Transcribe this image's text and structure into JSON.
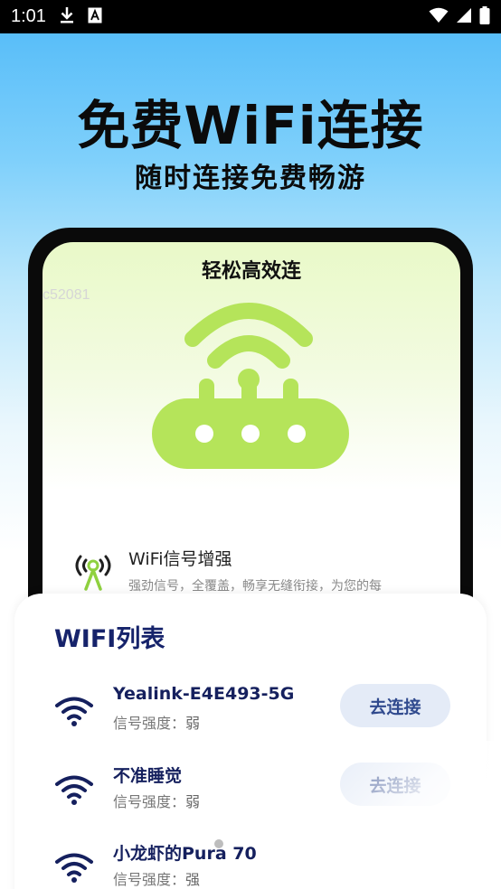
{
  "status_bar": {
    "time": "1:01",
    "icons_left": [
      "download-icon",
      "a-box-icon"
    ],
    "icons_right": [
      "wifi-signal-icon",
      "cell-signal-icon",
      "battery-icon"
    ]
  },
  "hero": {
    "title": "免费WiFi连接",
    "subtitle": "随时连接免费畅游"
  },
  "phone_mock": {
    "screen_title": "轻松高效连",
    "watermark": "c52081",
    "accent_color": "#b5e45a",
    "feature": {
      "title": "WiFi信号增强",
      "description": "强劲信号，全覆盖，畅享无缝衔接，为您的每"
    }
  },
  "wifi_list": {
    "title": "WIFI列表",
    "strength_label": "信号强度：",
    "items": [
      {
        "name": "Yealink-E4E493-5G",
        "strength": "弱",
        "button": "去连接"
      },
      {
        "name": "不准睡觉",
        "strength": "弱",
        "button": "去连接"
      },
      {
        "name": "小龙虾的Pura 70",
        "strength": "强",
        "button": ""
      }
    ]
  },
  "colors": {
    "brand_navy": "#15205e",
    "button_bg": "#e4ebf7",
    "sky_blue": "#4fb9f8"
  }
}
